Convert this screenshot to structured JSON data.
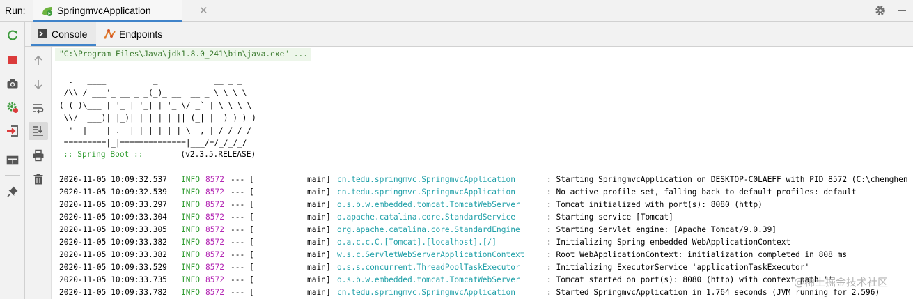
{
  "runbar": {
    "label": "Run:",
    "tab_title": "SpringmvcApplication",
    "close_glyph": "✕"
  },
  "subtabs": {
    "console_label": "Console",
    "endpoints_label": "Endpoints"
  },
  "console": {
    "command": "\"C:\\Program Files\\Java\\jdk1.8.0_241\\bin\\java.exe\" ...",
    "banner": [
      "  .   ____          _            __ _ _",
      " /\\\\ / ___'_ __ _ _(_)_ __  __ _ \\ \\ \\ \\",
      "( ( )\\___ | '_ | '_| | '_ \\/ _` | \\ \\ \\ \\",
      " \\\\/  ___)| |_)| | | | | || (_| |  ) ) ) )",
      "  '  |____| .__|_| |_|_| |_\\__, | / / / /",
      " =========|_|==============|___/=/_/_/_/"
    ],
    "boot_label": ":: Spring Boot ::",
    "boot_version": "(v2.3.5.RELEASE)",
    "logs": [
      {
        "ts": "2020-11-05 10:09:32.537",
        "level": "INFO",
        "pid": "8572",
        "sep": "--- [",
        "thread": "main]",
        "logger": "cn.tedu.springmvc.SpringmvcApplication",
        "msg": ": Starting SpringmvcApplication on DESKTOP-C0LAEFF with PID 8572 (C:\\chenghen"
      },
      {
        "ts": "2020-11-05 10:09:32.539",
        "level": "INFO",
        "pid": "8572",
        "sep": "--- [",
        "thread": "main]",
        "logger": "cn.tedu.springmvc.SpringmvcApplication",
        "msg": ": No active profile set, falling back to default profiles: default"
      },
      {
        "ts": "2020-11-05 10:09:33.297",
        "level": "INFO",
        "pid": "8572",
        "sep": "--- [",
        "thread": "main]",
        "logger": "o.s.b.w.embedded.tomcat.TomcatWebServer",
        "msg": ": Tomcat initialized with port(s): 8080 (http)"
      },
      {
        "ts": "2020-11-05 10:09:33.304",
        "level": "INFO",
        "pid": "8572",
        "sep": "--- [",
        "thread": "main]",
        "logger": "o.apache.catalina.core.StandardService",
        "msg": ": Starting service [Tomcat]"
      },
      {
        "ts": "2020-11-05 10:09:33.305",
        "level": "INFO",
        "pid": "8572",
        "sep": "--- [",
        "thread": "main]",
        "logger": "org.apache.catalina.core.StandardEngine",
        "msg": ": Starting Servlet engine: [Apache Tomcat/9.0.39]"
      },
      {
        "ts": "2020-11-05 10:09:33.382",
        "level": "INFO",
        "pid": "8572",
        "sep": "--- [",
        "thread": "main]",
        "logger": "o.a.c.c.C.[Tomcat].[localhost].[/]",
        "msg": ": Initializing Spring embedded WebApplicationContext"
      },
      {
        "ts": "2020-11-05 10:09:33.382",
        "level": "INFO",
        "pid": "8572",
        "sep": "--- [",
        "thread": "main]",
        "logger": "w.s.c.ServletWebServerApplicationContext",
        "msg": ": Root WebApplicationContext: initialization completed in 808 ms"
      },
      {
        "ts": "2020-11-05 10:09:33.529",
        "level": "INFO",
        "pid": "8572",
        "sep": "--- [",
        "thread": "main]",
        "logger": "o.s.s.concurrent.ThreadPoolTaskExecutor",
        "msg": ": Initializing ExecutorService 'applicationTaskExecutor'"
      },
      {
        "ts": "2020-11-05 10:09:33.735",
        "level": "INFO",
        "pid": "8572",
        "sep": "--- [",
        "thread": "main]",
        "logger": "o.s.b.w.embedded.tomcat.TomcatWebServer",
        "msg": ": Tomcat started on port(s): 8080 (http) with context path ''"
      },
      {
        "ts": "2020-11-05 10:09:33.782",
        "level": "INFO",
        "pid": "8572",
        "sep": "--- [",
        "thread": "main]",
        "logger": "cn.tedu.springmvc.SpringmvcApplication",
        "msg": ": Started SpringmvcApplication in 1.764 seconds (JVM running for 2.596)"
      }
    ]
  },
  "watermark": "@稀土掘金技术社区",
  "icons": [
    "rerun-icon",
    "stop-icon",
    "camera-icon",
    "debug-gear-icon",
    "exit-icon",
    "layout-icon",
    "pin-icon",
    "up-arrow-icon",
    "down-arrow-icon",
    "soft-wrap-icon",
    "scroll-to-end-icon",
    "print-icon",
    "trash-icon",
    "settings-gear-icon",
    "minimize-icon",
    "spring-app-icon",
    "console-icon",
    "endpoints-icon"
  ],
  "colors": {
    "accent": "#4083c9",
    "info": "#2e9b2e",
    "pid": "#b325b3",
    "logger": "#20a0a8",
    "command": "#3a7a2e"
  }
}
